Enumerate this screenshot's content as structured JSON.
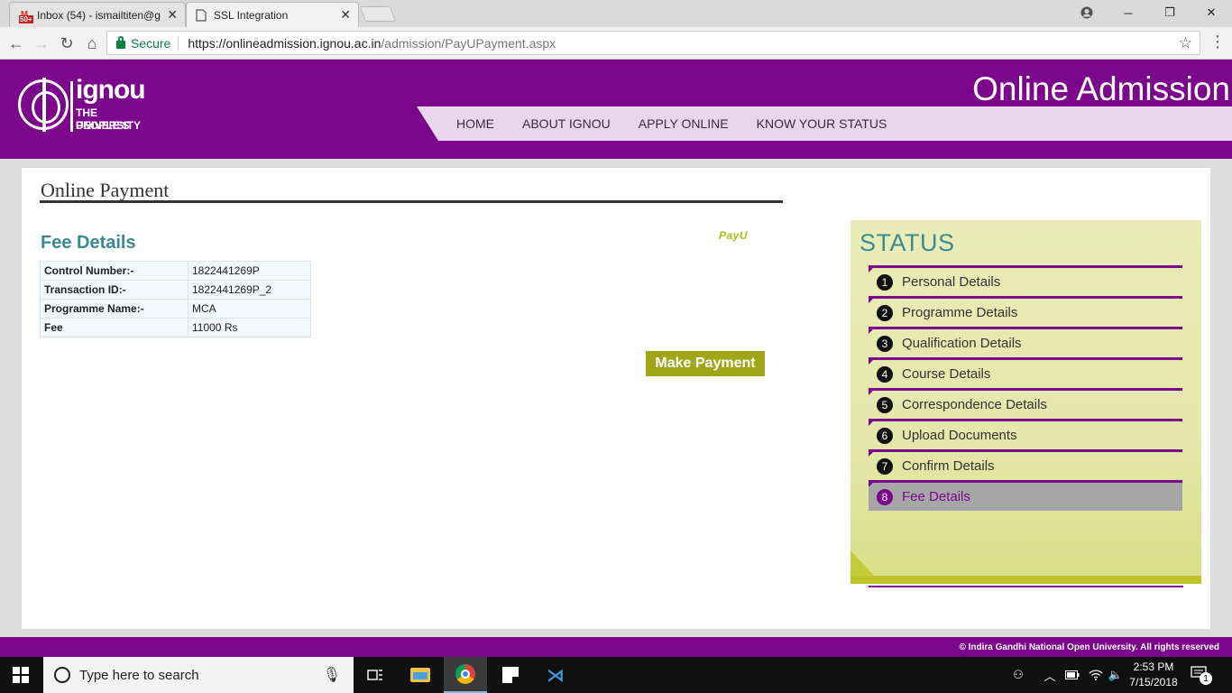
{
  "browser": {
    "tabs": [
      {
        "title": "Inbox (54) - ismailtiten@g",
        "icon": "gmail-icon",
        "badge": "50+"
      },
      {
        "title": "SSL Integration",
        "icon": "document-icon"
      }
    ],
    "secure_label": "Secure",
    "url_host": "https://onlineadmission.ignou.ac.in",
    "url_path": "/admission/PayUPayment.aspx"
  },
  "header": {
    "logo_wordmark": "ignou",
    "logo_tagline_1": "THE PEOPLE'S",
    "logo_tagline_2": "UNIVERSITY",
    "site_title": "Online Admission",
    "nav": [
      "HOME",
      "ABOUT IGNOU",
      "APPLY ONLINE",
      "KNOW YOUR STATUS"
    ]
  },
  "main": {
    "heading": "Online Payment",
    "fee_title": "Fee Details",
    "gateway_logo": "PayU",
    "fee_rows": [
      {
        "label": "Control Number:-",
        "value": "1822441269P"
      },
      {
        "label": "Transaction ID:-",
        "value": "1822441269P_2"
      },
      {
        "label": "Programme Name:-",
        "value": "MCA"
      },
      {
        "label": "Fee",
        "value": "11000 Rs"
      }
    ],
    "pay_button": "Make Payment"
  },
  "status": {
    "title": "STATUS",
    "steps": [
      {
        "num": "1",
        "label": "Personal Details"
      },
      {
        "num": "2",
        "label": "Programme Details"
      },
      {
        "num": "3",
        "label": "Qualification Details"
      },
      {
        "num": "4",
        "label": "Course Details"
      },
      {
        "num": "5",
        "label": "Correspondence Details"
      },
      {
        "num": "6",
        "label": "Upload Documents"
      },
      {
        "num": "7",
        "label": "Confirm Details"
      },
      {
        "num": "8",
        "label": "Fee Details"
      }
    ],
    "current_step": 8
  },
  "footer": {
    "copyright": "© Indira Gandhi National Open University. All rights reserved"
  },
  "taskbar": {
    "search_placeholder": "Type here to search",
    "time": "2:53 PM",
    "date": "7/15/2018",
    "notification_count": "1"
  },
  "colors": {
    "brand_purple": "#7b068b",
    "nav_bg": "#e8d6ec",
    "accent_teal": "#3a8a94",
    "pay_button": "#a1a619",
    "status_bg": "#e9ecb8"
  }
}
